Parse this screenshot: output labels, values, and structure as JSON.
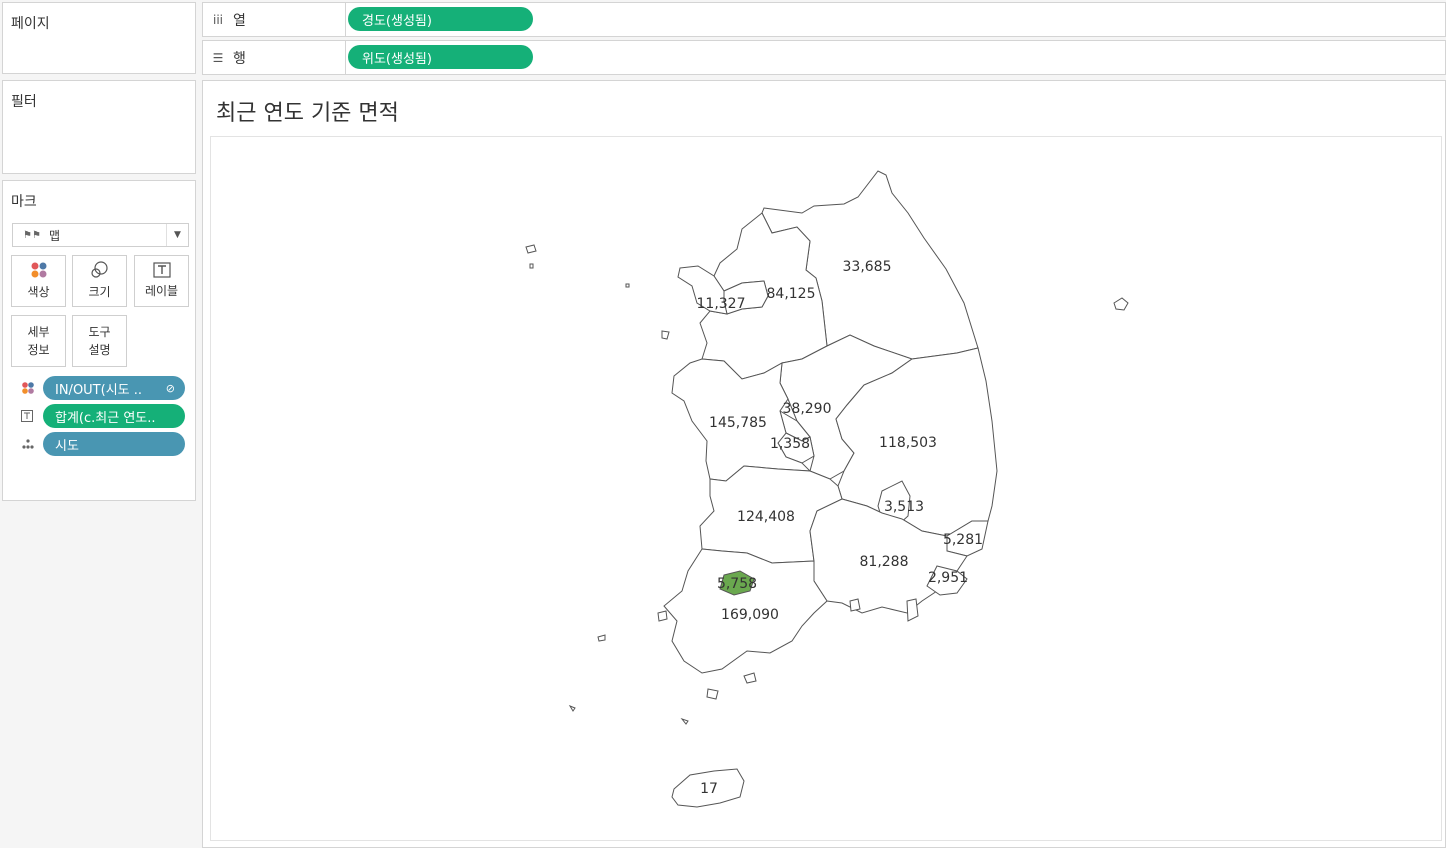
{
  "left_panel": {
    "pages_title": "페이지",
    "filters_title": "필터",
    "marks_title": "마크",
    "mark_type": "맵",
    "buttons": {
      "color": "색상",
      "size": "크기",
      "label": "레이블",
      "detail_line1": "세부",
      "detail_line2": "정보",
      "tooltip_line1": "도구",
      "tooltip_line2": "설명"
    },
    "fields": [
      {
        "label": "IN/OUT(시도 ..",
        "icon": "color-dots-icon",
        "color": "#4996b2"
      },
      {
        "label": "합계(c.최근 연도..",
        "icon": "text-label-icon",
        "color": "#15b078"
      },
      {
        "label": "시도",
        "icon": "detail-dots-icon",
        "color": "#4996b2"
      }
    ]
  },
  "shelves": {
    "columns_label": "열",
    "columns_pill": "경도(생성됨)",
    "rows_label": "행",
    "rows_pill": "위도(생성됨)"
  },
  "viz": {
    "title": "최근 연도 기준 면적",
    "highlight_color": "#6aa84f",
    "labels": [
      {
        "value": "33,685"
      },
      {
        "value": "84,125"
      },
      {
        "value": "11,327"
      },
      {
        "value": "38,290"
      },
      {
        "value": "145,785"
      },
      {
        "value": "1,358"
      },
      {
        "value": "118,503"
      },
      {
        "value": "3,513"
      },
      {
        "value": "124,408"
      },
      {
        "value": "5,281"
      },
      {
        "value": "81,288"
      },
      {
        "value": "2,951"
      },
      {
        "value": "5,758"
      },
      {
        "value": "169,090"
      },
      {
        "value": "17"
      }
    ]
  }
}
